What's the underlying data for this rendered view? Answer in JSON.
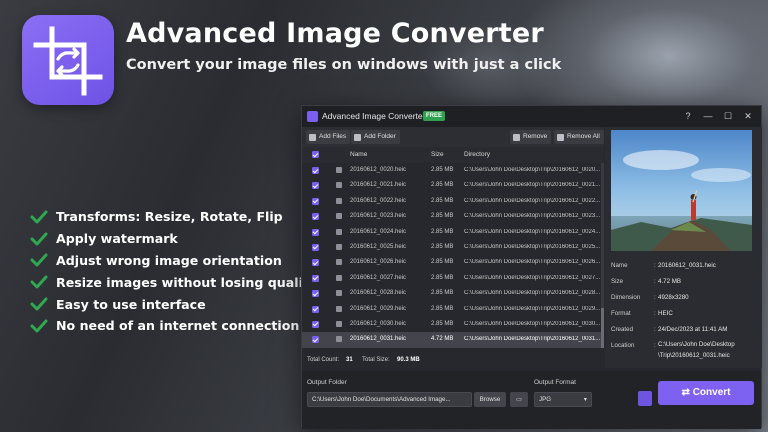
{
  "hero": {
    "title": "Advanced Image Converter",
    "subtitle": "Convert your image files on windows with just a click",
    "logo_icon": "crop-convert-icon",
    "features": [
      "Transforms: Resize, Rotate, Flip",
      "Apply watermark",
      "Adjust wrong image orientation",
      "Resize images without losing quality",
      "Easy to use interface",
      "No need of an internet connection"
    ]
  },
  "colors": {
    "accent": "#7d61f0",
    "check": "#2fa84f",
    "free_badge": "#2ea24f"
  },
  "window": {
    "title": "Advanced Image Converter",
    "badge": "FREE",
    "controls": [
      "?",
      "—",
      "☐",
      "✕"
    ]
  },
  "toolbar": {
    "add_files": "Add Files",
    "add_folder": "Add Folder",
    "remove": "Remove",
    "remove_all": "Remove All"
  },
  "table": {
    "headers": {
      "name": "Name",
      "size": "Size",
      "directory": "Directory"
    },
    "rows": [
      {
        "name": "20160612_0020.heic",
        "size": "2.85 MB",
        "dir": "C:\\Users\\John Doe\\Desktop\\Trip\\20160612_0020..."
      },
      {
        "name": "20160612_0021.heic",
        "size": "2.85 MB",
        "dir": "C:\\Users\\John Doe\\Desktop\\Trip\\20160612_0021..."
      },
      {
        "name": "20160612_0022.heic",
        "size": "2.85 MB",
        "dir": "C:\\Users\\John Doe\\Desktop\\Trip\\20160612_0022..."
      },
      {
        "name": "20160612_0023.heic",
        "size": "2.85 MB",
        "dir": "C:\\Users\\John Doe\\Desktop\\Trip\\20160612_0023..."
      },
      {
        "name": "20160612_0024.heic",
        "size": "2.85 MB",
        "dir": "C:\\Users\\John Doe\\Desktop\\Trip\\20160612_0024..."
      },
      {
        "name": "20160612_0025.heic",
        "size": "2.85 MB",
        "dir": "C:\\Users\\John Doe\\Desktop\\Trip\\20160612_0025..."
      },
      {
        "name": "20160612_0026.heic",
        "size": "2.85 MB",
        "dir": "C:\\Users\\John Doe\\Desktop\\Trip\\20160612_0026..."
      },
      {
        "name": "20160612_0027.heic",
        "size": "2.85 MB",
        "dir": "C:\\Users\\John Doe\\Desktop\\Trip\\20160612_0027..."
      },
      {
        "name": "20160612_0028.heic",
        "size": "2.85 MB",
        "dir": "C:\\Users\\John Doe\\Desktop\\Trip\\20160612_0028..."
      },
      {
        "name": "20160612_0029.heic",
        "size": "2.85 MB",
        "dir": "C:\\Users\\John Doe\\Desktop\\Trip\\20160612_0029..."
      },
      {
        "name": "20160612_0030.heic",
        "size": "2.85 MB",
        "dir": "C:\\Users\\John Doe\\Desktop\\Trip\\20160612_0030..."
      },
      {
        "name": "20160612_0031.heic",
        "size": "4.72 MB",
        "dir": "C:\\Users\\John Doe\\Desktop\\Trip\\20160612_0031..."
      }
    ]
  },
  "totals": {
    "count_label": "Total Count:",
    "count": "31",
    "size_label": "Total Size:",
    "size": "90.3 MB"
  },
  "details": {
    "name": {
      "label": "Name",
      "value": "20160612_0031.heic"
    },
    "size": {
      "label": "Size",
      "value": "4.72 MB"
    },
    "dimension": {
      "label": "Dimension",
      "value": "4928x3280"
    },
    "format": {
      "label": "Format",
      "value": "HEIC"
    },
    "created": {
      "label": "Created",
      "value": "24/Dec/2023 at 11:41 AM"
    },
    "location": {
      "label": "Location",
      "line1": "C:\\Users\\John Doe\\Desktop",
      "line2": "\\Trip\\20160612_0031.heic"
    }
  },
  "bottom": {
    "output_folder_label": "Output Folder",
    "output_folder_value": "C:\\Users\\John Doe\\Documents\\Advanced Image...",
    "browse": "Browse",
    "output_format_label": "Output Format",
    "output_format_value": "JPG",
    "convert": "Convert"
  }
}
